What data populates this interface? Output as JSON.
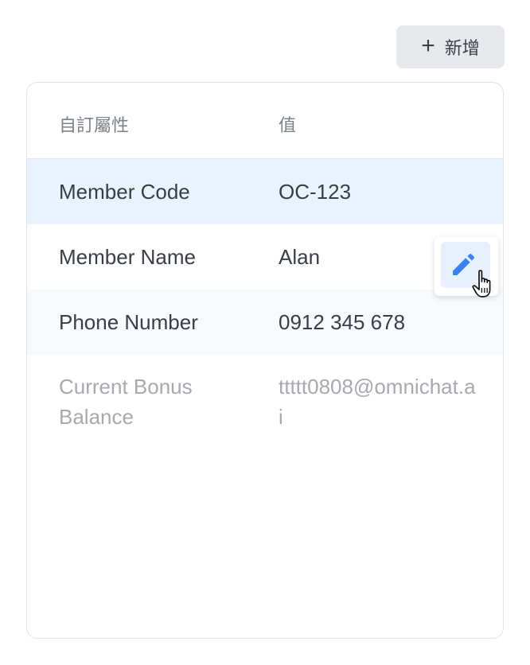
{
  "toolbar": {
    "add_label": "新增",
    "add_icon": "plus-icon"
  },
  "table": {
    "headers": {
      "key": "自訂屬性",
      "value": "值"
    },
    "rows": [
      {
        "key": "Member Code",
        "value": "OC-123"
      },
      {
        "key": "Member Name",
        "value": "Alan"
      },
      {
        "key": "Phone Number",
        "value": "0912 345 678"
      },
      {
        "key": "Current Bonus Balance",
        "value": "ttttt0808@omnichat.ai"
      }
    ]
  },
  "row_actions": {
    "icon": "pencil-icon"
  },
  "colors": {
    "accent": "#3b82f6",
    "highlight_row": "#e9f3fd"
  }
}
